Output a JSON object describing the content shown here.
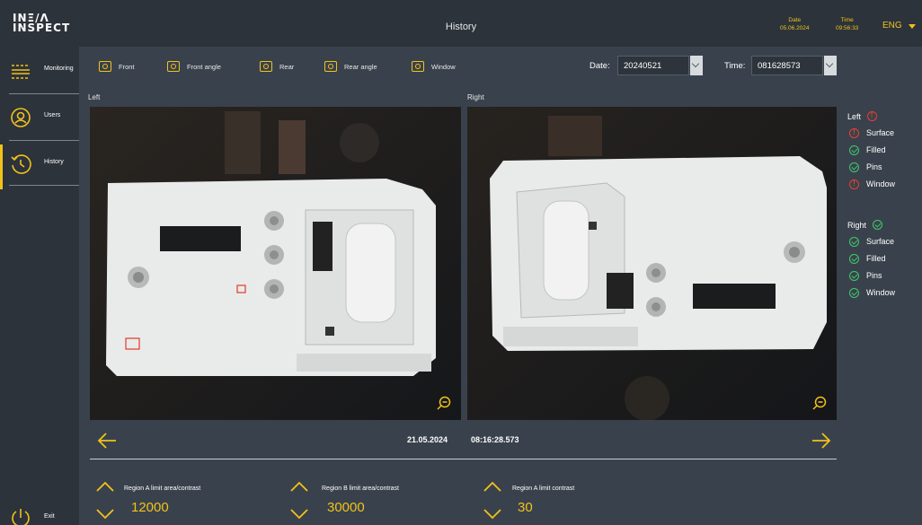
{
  "header": {
    "logo_line1": "INΞ/Λ",
    "logo_line2": "INSPECT",
    "title": "History",
    "date_label": "Date",
    "date_value": "05.06.2024",
    "time_label": "Time",
    "time_value": "09:56:33",
    "language": "ENG"
  },
  "sidebar": {
    "items": [
      {
        "label": "Monitoring",
        "icon": "monitoring-icon"
      },
      {
        "label": "Users",
        "icon": "user-icon"
      },
      {
        "label": "History",
        "icon": "history-icon",
        "active": true
      }
    ],
    "exit_label": "Exit"
  },
  "toolbar": {
    "views": [
      "Front",
      "Front angle",
      "Rear",
      "Rear angle",
      "Window"
    ],
    "date_label": "Date:",
    "date_value": "20240521",
    "time_label": "Time:",
    "time_value": "081628573"
  },
  "panels": {
    "left_label": "Left",
    "right_label": "Right"
  },
  "status": {
    "left": {
      "title": "Left",
      "result": "error",
      "checks": [
        {
          "label": "Surface",
          "result": "error"
        },
        {
          "label": "Filled",
          "result": "ok"
        },
        {
          "label": "Pins",
          "result": "ok"
        },
        {
          "label": "Window",
          "result": "error"
        }
      ]
    },
    "right": {
      "title": "Right",
      "result": "ok",
      "checks": [
        {
          "label": "Surface",
          "result": "ok"
        },
        {
          "label": "Filled",
          "result": "ok"
        },
        {
          "label": "Pins",
          "result": "ok"
        },
        {
          "label": "Window",
          "result": "ok"
        }
      ]
    }
  },
  "navigation": {
    "date": "21.05.2024",
    "time": "08:16:28.573"
  },
  "limits": [
    {
      "label": "Region A limit area/contrast",
      "value": "12000"
    },
    {
      "label": "Region B limit area/contrast",
      "value": "30000"
    },
    {
      "label": "Region A limit contrast",
      "value": "30"
    }
  ],
  "colors": {
    "accent": "#f2c21b",
    "ok": "#3ec96b",
    "error": "#e8402f",
    "background": "#39424c",
    "bar": "#2c333b"
  }
}
